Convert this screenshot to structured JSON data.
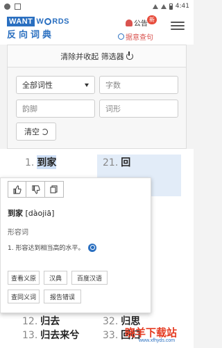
{
  "status_bar": {
    "time": "4:41"
  },
  "header": {
    "logo_want": "WANT",
    "logo_words": "WRDS",
    "logo_subtitle": "反向词典",
    "notice_label": "公告",
    "new_badge": "新",
    "lookup_label": "据意查句"
  },
  "filter": {
    "title": "清除并收起 筛选器",
    "pos_select": "全部词性",
    "char_count_placeholder": "字数",
    "rhyme_placeholder": "韵脚",
    "shape_placeholder": "词形",
    "clear_label": "清空"
  },
  "results": {
    "items": [
      {
        "num": "1.",
        "word": "到家"
      },
      {
        "num": "21.",
        "word": "回"
      },
      {
        "num": "12.",
        "word": "归去"
      },
      {
        "num": "32.",
        "word": "归思"
      },
      {
        "num": "13.",
        "word": "归去来兮"
      },
      {
        "num": "33.",
        "word": "回归"
      }
    ]
  },
  "popup": {
    "word": "到家",
    "pinyin": "[dàojiā]",
    "pos": "形容词",
    "definition": "1. 形容达到相当高的水平。",
    "links": [
      "查看义原",
      "汉典",
      "百度汉语",
      "查同义词",
      "报告错误"
    ]
  },
  "watermark": {
    "text": "晓羊下载站",
    "url": "www.xfhyds.com"
  },
  "colors": {
    "brand": "#2a6fc0",
    "accent": "#e74c3c",
    "highlight": "#cfe0f7"
  }
}
